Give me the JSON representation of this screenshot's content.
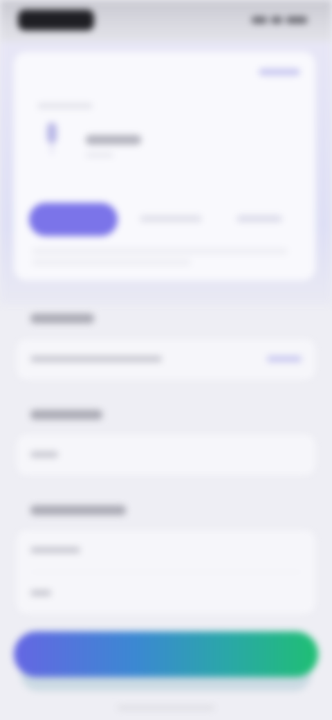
{
  "status_bar": {
    "time": "",
    "icons": [
      "signal-icon",
      "wifi-icon",
      "battery-icon"
    ]
  },
  "card": {
    "top_link": "",
    "kicker": "",
    "title": "",
    "subtitle": "",
    "segments": [
      "",
      "",
      ""
    ],
    "active_segment": 0,
    "note": ""
  },
  "sections": [
    {
      "label": "",
      "rows": [
        {
          "text": "",
          "link": ""
        }
      ]
    },
    {
      "label": "",
      "rows": [
        {
          "text": ""
        }
      ]
    },
    {
      "label": "",
      "rows": [
        {
          "text": ""
        },
        {
          "text": ""
        }
      ]
    }
  ],
  "cta": {
    "label": ""
  },
  "colors": {
    "accent": "#7b74e9",
    "cta_start": "#6566e3",
    "cta_end": "#1fbf73",
    "background": "#eeeef4"
  }
}
